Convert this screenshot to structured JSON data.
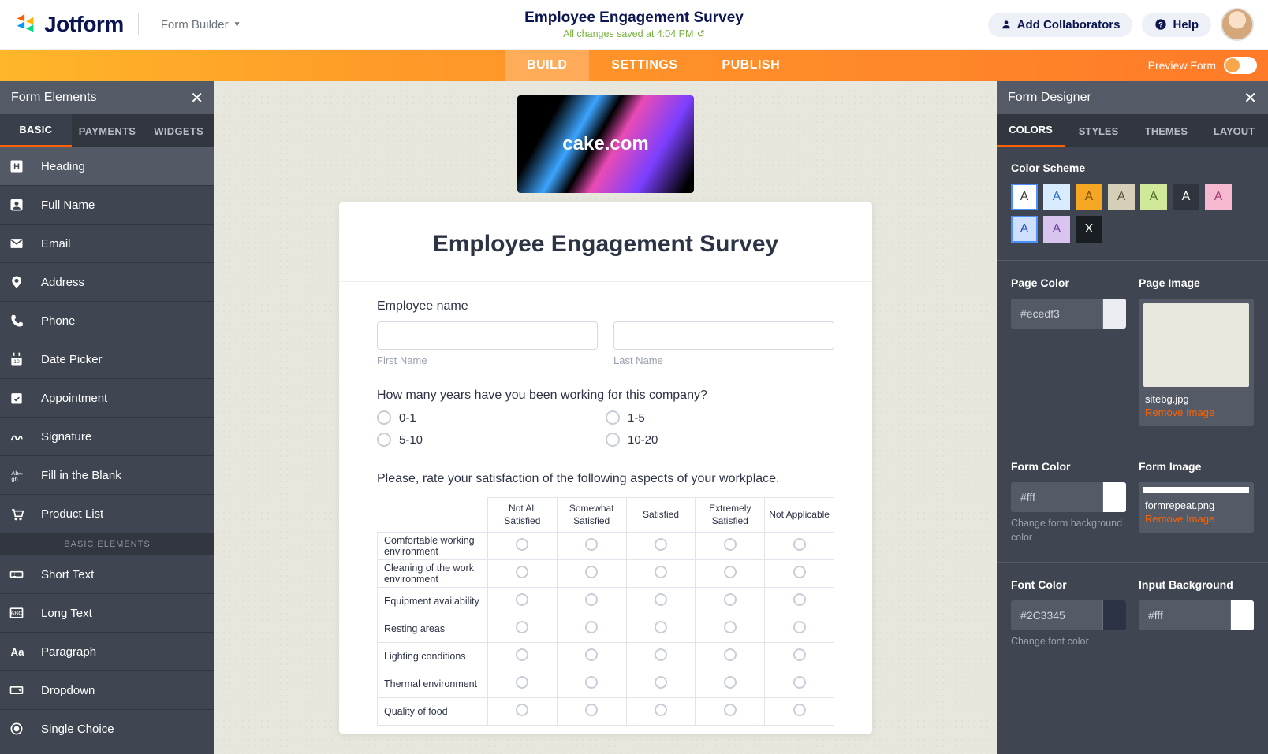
{
  "header": {
    "brand": "Jotform",
    "form_builder": "Form Builder",
    "title": "Employee Engagement Survey",
    "saved": "All changes saved at 4:04 PM",
    "collaborators_btn": "Add Collaborators",
    "help_btn": "Help"
  },
  "main_tabs": {
    "build": "BUILD",
    "settings": "SETTINGS",
    "publish": "PUBLISH"
  },
  "preview_label": "Preview Form",
  "left_panel": {
    "title": "Form Elements",
    "tabs": {
      "basic": "BASIC",
      "payments": "PAYMENTS",
      "widgets": "WIDGETS"
    },
    "items": [
      "Heading",
      "Full Name",
      "Email",
      "Address",
      "Phone",
      "Date Picker",
      "Appointment",
      "Signature",
      "Fill in the Blank",
      "Product List"
    ],
    "section": "BASIC ELEMENTS",
    "items2": [
      "Short Text",
      "Long Text",
      "Paragraph",
      "Dropdown",
      "Single Choice"
    ]
  },
  "form": {
    "logo_text": "cake.com",
    "title": "Employee Engagement Survey",
    "employee_name_label": "Employee name",
    "first_name_sub": "First Name",
    "last_name_sub": "Last Name",
    "years_q": "How many years have you been working for this company?",
    "years_opts": [
      "0-1",
      "1-5",
      "5-10",
      "10-20"
    ],
    "matrix_q": "Please, rate your satisfaction of the following aspects of your workplace.",
    "matrix_cols": [
      "Not All Satisfied",
      "Somewhat Satisfied",
      "Satisfied",
      "Extremely Satisfied",
      "Not Applicable"
    ],
    "matrix_rows": [
      "Comfortable working environment",
      "Cleaning of the work environment",
      "Equipment availability",
      "Resting areas",
      "Lighting conditions",
      "Thermal environment",
      "Quality of food"
    ]
  },
  "designer": {
    "title": "Form Designer",
    "tabs": {
      "colors": "COLORS",
      "styles": "STYLES",
      "themes": "THEMES",
      "layout": "LAYOUT"
    },
    "color_scheme": "Color Scheme",
    "swatches": [
      {
        "bg": "#ffffff",
        "fg": "#3a3a3a",
        "sel": true
      },
      {
        "bg": "#d9ecff",
        "fg": "#2a6cc9"
      },
      {
        "bg": "#f5a623",
        "fg": "#7a4b00"
      },
      {
        "bg": "#d6cfb8",
        "fg": "#5a533e"
      },
      {
        "bg": "#cfe89a",
        "fg": "#4e6b1e"
      },
      {
        "bg": "#2f343d",
        "fg": "#ffffff"
      },
      {
        "bg": "#f5b8cf",
        "fg": "#a03a6a"
      },
      {
        "bg": "#cfe0ff",
        "fg": "#2c54b2",
        "sel": true
      },
      {
        "bg": "#d9c4ef",
        "fg": "#6b3fa0"
      },
      {
        "bg": "#1a1d22",
        "fg": "#ffffff",
        "label": "X"
      }
    ],
    "page_color_label": "Page Color",
    "page_color": "#ecedf3",
    "page_image_label": "Page Image",
    "page_image_name": "sitebg.jpg",
    "remove_image": "Remove Image",
    "form_color_label": "Form Color",
    "form_color": "#fff",
    "form_color_help": "Change form background color",
    "form_image_label": "Form Image",
    "form_image_name": "formrepeat.png",
    "font_color_label": "Font Color",
    "font_color": "#2C3345",
    "font_color_help": "Change font color",
    "input_bg_label": "Input Background",
    "input_bg": "#fff"
  }
}
